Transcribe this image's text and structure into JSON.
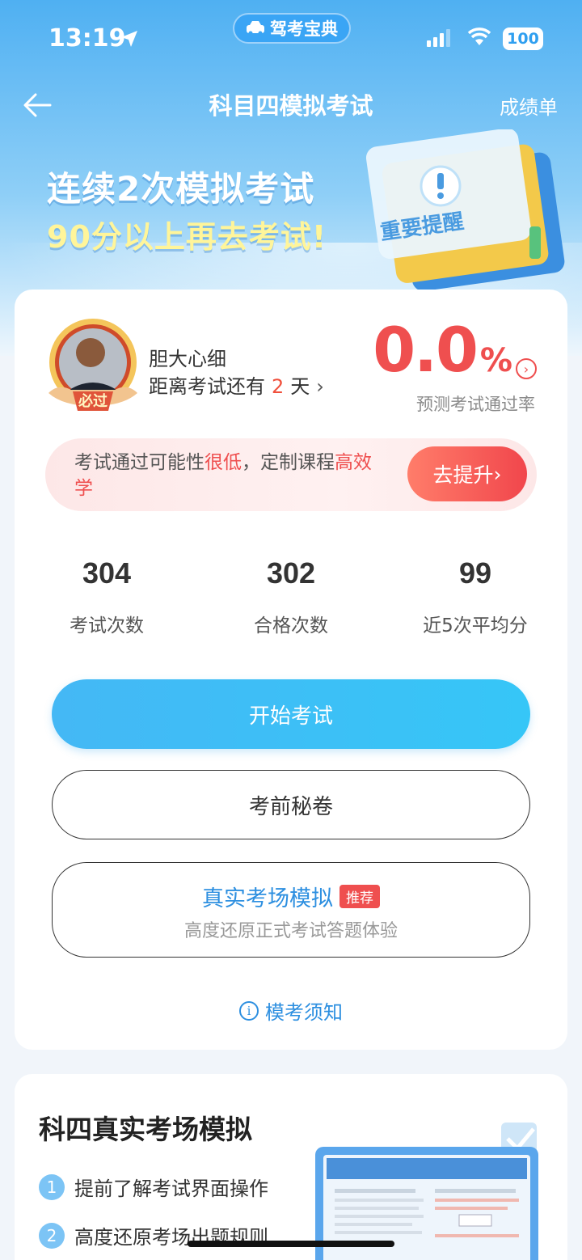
{
  "status_bar": {
    "time": "13:19",
    "app_name": "驾考宝典",
    "battery": "100"
  },
  "nav": {
    "title": "科目四模拟考试",
    "right_link": "成绩单"
  },
  "banner": {
    "line1": "连续2次模拟考试",
    "line2": "90分以上再去考试!",
    "reminder_text": "重要提醒"
  },
  "profile": {
    "badge_text": "必过",
    "name": "胆大心细",
    "countdown_prefix": "距离考试还有",
    "countdown_days": "2",
    "countdown_suffix": "天",
    "pass_rate": "0.0",
    "pass_rate_unit": "%",
    "pass_rate_label": "预测考试通过率"
  },
  "tip": {
    "text_part1": "考试通过可能性",
    "text_red1": "很低",
    "text_part2": "，定制课程",
    "text_red2": "高效学",
    "button": "去提升"
  },
  "stats": [
    {
      "value": "304",
      "label": "考试次数"
    },
    {
      "value": "302",
      "label": "合格次数"
    },
    {
      "value": "99",
      "label": "近5次平均分"
    }
  ],
  "buttons": {
    "start": "开始考试",
    "secret": "考前秘卷",
    "real_title": "真实考场模拟",
    "real_badge": "推荐",
    "real_sub": "高度还原正式考试答题体验",
    "notice": "模考须知"
  },
  "section2": {
    "title": "科四真实考场模拟",
    "features": [
      {
        "num": "1",
        "text": "提前了解考试界面操作"
      },
      {
        "num": "2",
        "text": "高度还原考场出题规则"
      }
    ]
  },
  "colors": {
    "accent": "#2d8fe0",
    "danger": "#ef4f4f",
    "primary_button": "#44b8f5"
  }
}
